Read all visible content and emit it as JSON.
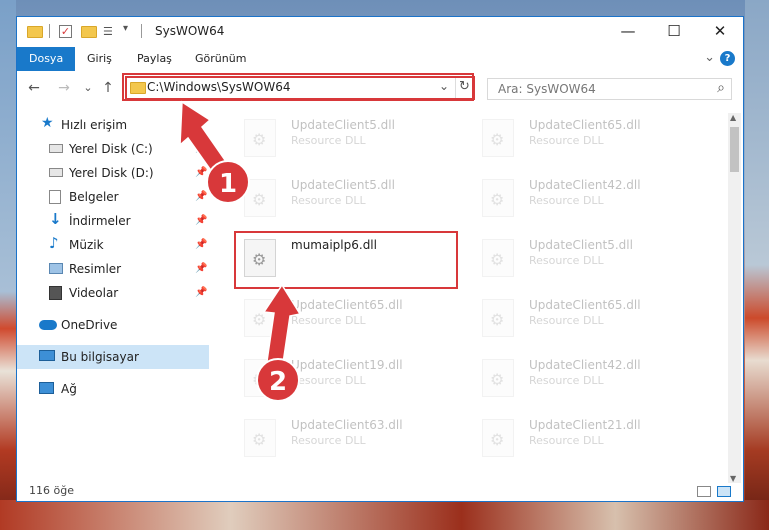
{
  "window": {
    "title": "SysWOW64",
    "minimize_glyph": "—",
    "maximize_glyph": "☐",
    "close_glyph": "✕"
  },
  "ribbon": {
    "tabs": [
      {
        "label": "Dosya",
        "active": true
      },
      {
        "label": "Giriş",
        "active": false
      },
      {
        "label": "Paylaş",
        "active": false
      },
      {
        "label": "Görünüm",
        "active": false
      }
    ],
    "expand_glyph": "⌄",
    "help_glyph": "?"
  },
  "nav": {
    "back_glyph": "←",
    "forward_glyph": "→",
    "recent_glyph": "⌄",
    "up_glyph": "↑",
    "address": "C:\\Windows\\SysWOW64",
    "address_dropdown_glyph": "⌄",
    "refresh_glyph": "↻",
    "search_placeholder": "Ara: SysWOW64",
    "search_glyph": "⌕"
  },
  "sidebar": {
    "items": [
      {
        "label": "Hızlı erişim",
        "icon": "star-icon",
        "pinned": false
      },
      {
        "label": "Yerel Disk (C:)",
        "icon": "drive-icon",
        "pinned": true
      },
      {
        "label": "Yerel Disk (D:)",
        "icon": "drive-icon",
        "pinned": true
      },
      {
        "label": "Belgeler",
        "icon": "documents-icon",
        "pinned": true
      },
      {
        "label": "İndirmeler",
        "icon": "download-icon",
        "pinned": true
      },
      {
        "label": "Müzik",
        "icon": "music-icon",
        "pinned": true
      },
      {
        "label": "Resimler",
        "icon": "pictures-icon",
        "pinned": true
      },
      {
        "label": "Videolar",
        "icon": "videos-icon",
        "pinned": true
      },
      {
        "label": "OneDrive",
        "icon": "cloud-icon",
        "pinned": false
      },
      {
        "label": "Bu bilgisayar",
        "icon": "computer-icon",
        "pinned": false,
        "selected": true
      },
      {
        "label": "Ağ",
        "icon": "network-icon",
        "pinned": false
      }
    ],
    "pin_glyph": "📌"
  },
  "files": {
    "left": [
      {
        "name": "UpdateClient5.dll",
        "desc": "Resource DLL"
      },
      {
        "name": "UpdateClient5.dll",
        "desc": "Resource DLL"
      },
      {
        "name": "mumaiplp6.dll",
        "desc": ""
      },
      {
        "name": "UpdateClient65.dll",
        "desc": "Resource DLL"
      },
      {
        "name": "UpdateClient19.dll",
        "desc": "Resource DLL"
      },
      {
        "name": "UpdateClient63.dll",
        "desc": "Resource DLL"
      }
    ],
    "right": [
      {
        "name": "UpdateClient65.dll",
        "desc": "Resource DLL"
      },
      {
        "name": "UpdateClient42.dll",
        "desc": "Resource DLL"
      },
      {
        "name": "UpdateClient5.dll",
        "desc": "Resource DLL"
      },
      {
        "name": "UpdateClient65.dll",
        "desc": "Resource DLL"
      },
      {
        "name": "UpdateClient42.dll",
        "desc": "Resource DLL"
      },
      {
        "name": "UpdateClient21.dll",
        "desc": "Resource DLL"
      }
    ]
  },
  "status": {
    "count": "116 öğe"
  },
  "annotations": {
    "step1": "1",
    "step2": "2"
  },
  "colors": {
    "accent": "#1979ca",
    "highlight": "#d8383a",
    "selection": "#cce4f7"
  }
}
